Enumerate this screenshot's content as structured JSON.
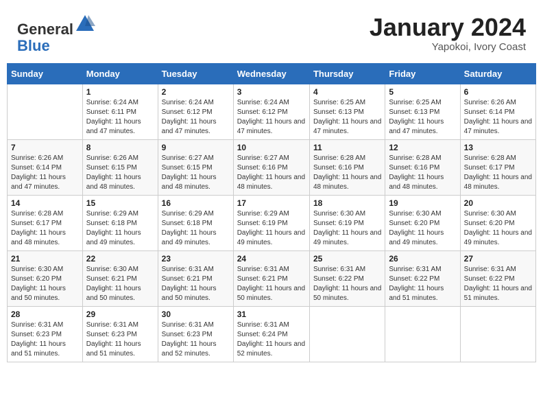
{
  "header": {
    "logo_line1": "General",
    "logo_line2": "Blue",
    "month": "January 2024",
    "location": "Yapokoi, Ivory Coast"
  },
  "weekdays": [
    "Sunday",
    "Monday",
    "Tuesday",
    "Wednesday",
    "Thursday",
    "Friday",
    "Saturday"
  ],
  "weeks": [
    [
      {
        "day": "",
        "sunrise": "",
        "sunset": "",
        "daylight": ""
      },
      {
        "day": "1",
        "sunrise": "Sunrise: 6:24 AM",
        "sunset": "Sunset: 6:11 PM",
        "daylight": "Daylight: 11 hours and 47 minutes."
      },
      {
        "day": "2",
        "sunrise": "Sunrise: 6:24 AM",
        "sunset": "Sunset: 6:12 PM",
        "daylight": "Daylight: 11 hours and 47 minutes."
      },
      {
        "day": "3",
        "sunrise": "Sunrise: 6:24 AM",
        "sunset": "Sunset: 6:12 PM",
        "daylight": "Daylight: 11 hours and 47 minutes."
      },
      {
        "day": "4",
        "sunrise": "Sunrise: 6:25 AM",
        "sunset": "Sunset: 6:13 PM",
        "daylight": "Daylight: 11 hours and 47 minutes."
      },
      {
        "day": "5",
        "sunrise": "Sunrise: 6:25 AM",
        "sunset": "Sunset: 6:13 PM",
        "daylight": "Daylight: 11 hours and 47 minutes."
      },
      {
        "day": "6",
        "sunrise": "Sunrise: 6:26 AM",
        "sunset": "Sunset: 6:14 PM",
        "daylight": "Daylight: 11 hours and 47 minutes."
      }
    ],
    [
      {
        "day": "7",
        "sunrise": "Sunrise: 6:26 AM",
        "sunset": "Sunset: 6:14 PM",
        "daylight": "Daylight: 11 hours and 47 minutes."
      },
      {
        "day": "8",
        "sunrise": "Sunrise: 6:26 AM",
        "sunset": "Sunset: 6:15 PM",
        "daylight": "Daylight: 11 hours and 48 minutes."
      },
      {
        "day": "9",
        "sunrise": "Sunrise: 6:27 AM",
        "sunset": "Sunset: 6:15 PM",
        "daylight": "Daylight: 11 hours and 48 minutes."
      },
      {
        "day": "10",
        "sunrise": "Sunrise: 6:27 AM",
        "sunset": "Sunset: 6:16 PM",
        "daylight": "Daylight: 11 hours and 48 minutes."
      },
      {
        "day": "11",
        "sunrise": "Sunrise: 6:28 AM",
        "sunset": "Sunset: 6:16 PM",
        "daylight": "Daylight: 11 hours and 48 minutes."
      },
      {
        "day": "12",
        "sunrise": "Sunrise: 6:28 AM",
        "sunset": "Sunset: 6:16 PM",
        "daylight": "Daylight: 11 hours and 48 minutes."
      },
      {
        "day": "13",
        "sunrise": "Sunrise: 6:28 AM",
        "sunset": "Sunset: 6:17 PM",
        "daylight": "Daylight: 11 hours and 48 minutes."
      }
    ],
    [
      {
        "day": "14",
        "sunrise": "Sunrise: 6:28 AM",
        "sunset": "Sunset: 6:17 PM",
        "daylight": "Daylight: 11 hours and 48 minutes."
      },
      {
        "day": "15",
        "sunrise": "Sunrise: 6:29 AM",
        "sunset": "Sunset: 6:18 PM",
        "daylight": "Daylight: 11 hours and 49 minutes."
      },
      {
        "day": "16",
        "sunrise": "Sunrise: 6:29 AM",
        "sunset": "Sunset: 6:18 PM",
        "daylight": "Daylight: 11 hours and 49 minutes."
      },
      {
        "day": "17",
        "sunrise": "Sunrise: 6:29 AM",
        "sunset": "Sunset: 6:19 PM",
        "daylight": "Daylight: 11 hours and 49 minutes."
      },
      {
        "day": "18",
        "sunrise": "Sunrise: 6:30 AM",
        "sunset": "Sunset: 6:19 PM",
        "daylight": "Daylight: 11 hours and 49 minutes."
      },
      {
        "day": "19",
        "sunrise": "Sunrise: 6:30 AM",
        "sunset": "Sunset: 6:20 PM",
        "daylight": "Daylight: 11 hours and 49 minutes."
      },
      {
        "day": "20",
        "sunrise": "Sunrise: 6:30 AM",
        "sunset": "Sunset: 6:20 PM",
        "daylight": "Daylight: 11 hours and 49 minutes."
      }
    ],
    [
      {
        "day": "21",
        "sunrise": "Sunrise: 6:30 AM",
        "sunset": "Sunset: 6:20 PM",
        "daylight": "Daylight: 11 hours and 50 minutes."
      },
      {
        "day": "22",
        "sunrise": "Sunrise: 6:30 AM",
        "sunset": "Sunset: 6:21 PM",
        "daylight": "Daylight: 11 hours and 50 minutes."
      },
      {
        "day": "23",
        "sunrise": "Sunrise: 6:31 AM",
        "sunset": "Sunset: 6:21 PM",
        "daylight": "Daylight: 11 hours and 50 minutes."
      },
      {
        "day": "24",
        "sunrise": "Sunrise: 6:31 AM",
        "sunset": "Sunset: 6:21 PM",
        "daylight": "Daylight: 11 hours and 50 minutes."
      },
      {
        "day": "25",
        "sunrise": "Sunrise: 6:31 AM",
        "sunset": "Sunset: 6:22 PM",
        "daylight": "Daylight: 11 hours and 50 minutes."
      },
      {
        "day": "26",
        "sunrise": "Sunrise: 6:31 AM",
        "sunset": "Sunset: 6:22 PM",
        "daylight": "Daylight: 11 hours and 51 minutes."
      },
      {
        "day": "27",
        "sunrise": "Sunrise: 6:31 AM",
        "sunset": "Sunset: 6:22 PM",
        "daylight": "Daylight: 11 hours and 51 minutes."
      }
    ],
    [
      {
        "day": "28",
        "sunrise": "Sunrise: 6:31 AM",
        "sunset": "Sunset: 6:23 PM",
        "daylight": "Daylight: 11 hours and 51 minutes."
      },
      {
        "day": "29",
        "sunrise": "Sunrise: 6:31 AM",
        "sunset": "Sunset: 6:23 PM",
        "daylight": "Daylight: 11 hours and 51 minutes."
      },
      {
        "day": "30",
        "sunrise": "Sunrise: 6:31 AM",
        "sunset": "Sunset: 6:23 PM",
        "daylight": "Daylight: 11 hours and 52 minutes."
      },
      {
        "day": "31",
        "sunrise": "Sunrise: 6:31 AM",
        "sunset": "Sunset: 6:24 PM",
        "daylight": "Daylight: 11 hours and 52 minutes."
      },
      {
        "day": "",
        "sunrise": "",
        "sunset": "",
        "daylight": ""
      },
      {
        "day": "",
        "sunrise": "",
        "sunset": "",
        "daylight": ""
      },
      {
        "day": "",
        "sunrise": "",
        "sunset": "",
        "daylight": ""
      }
    ]
  ]
}
